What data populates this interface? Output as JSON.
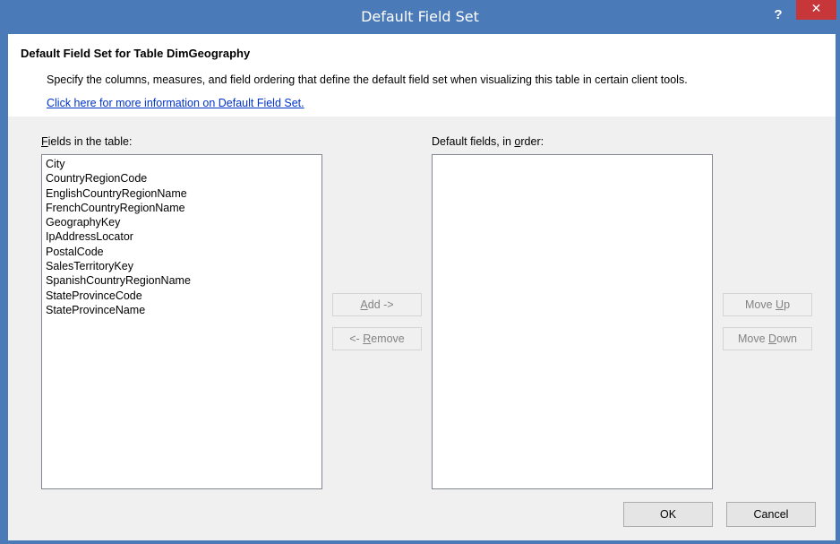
{
  "window": {
    "title": "Default Field Set",
    "help_glyph": "?",
    "close_glyph": "✕",
    "titlebar_color": "#4a7ab8",
    "close_color": "#c7373a"
  },
  "header": {
    "title": "Default Field Set for Table DimGeography",
    "description": "Specify the columns, measures, and field ordering that define the default field set when visualizing this table in certain client tools.",
    "link": "Click here for more information on Default Field Set."
  },
  "fields_panel": {
    "label_mnemonic": "F",
    "label_rest": "ields in the table:",
    "items": [
      "City",
      "CountryRegionCode",
      "EnglishCountryRegionName",
      "FrenchCountryRegionName",
      "GeographyKey",
      "IpAddressLocator",
      "PostalCode",
      "SalesTerritoryKey",
      "SpanishCountryRegionName",
      "StateProvinceCode",
      "StateProvinceName"
    ]
  },
  "default_panel": {
    "label_prefix": "Default fields, in ",
    "label_mnemonic": "o",
    "label_rest": "rder:",
    "items": []
  },
  "buttons": {
    "add_mnemonic": "A",
    "add_rest": "dd ->",
    "remove_prefix": "<- ",
    "remove_mnemonic": "R",
    "remove_rest": "emove",
    "moveup_prefix": "Move ",
    "moveup_mnemonic": "U",
    "moveup_rest": "p",
    "movedown_prefix": "Move ",
    "movedown_mnemonic": "D",
    "movedown_rest": "own",
    "ok": "OK",
    "cancel": "Cancel"
  }
}
